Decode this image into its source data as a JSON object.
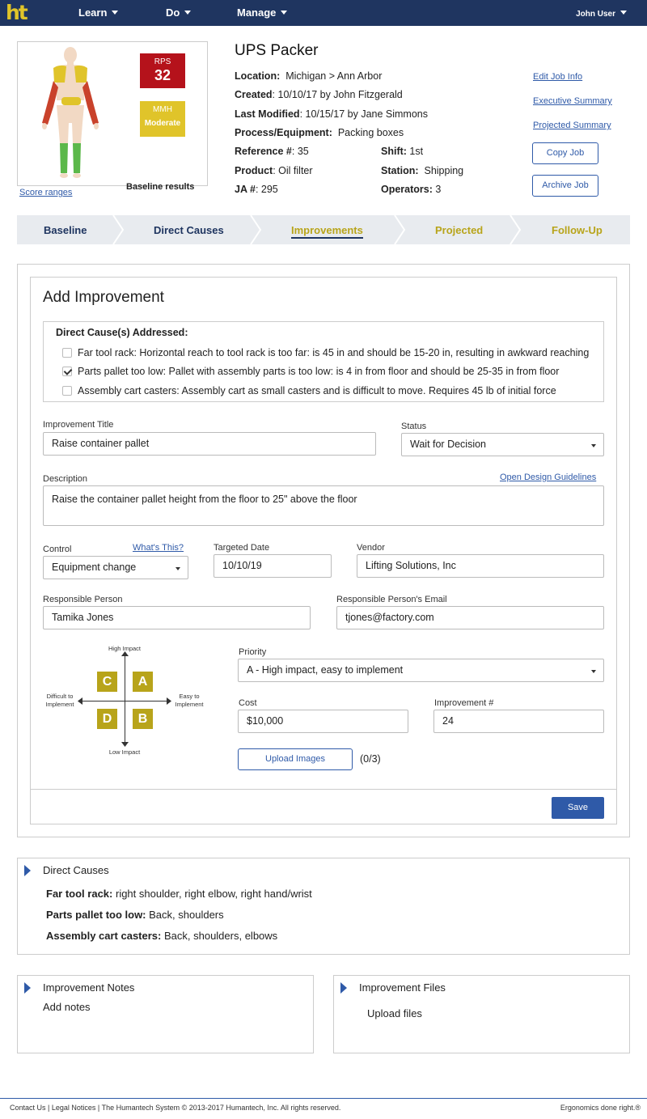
{
  "nav": {
    "logo": "ht",
    "learn": "Learn",
    "do": "Do",
    "manage": "Manage",
    "user": "John User"
  },
  "job": {
    "title": "UPS Packer",
    "rps_label": "RPS",
    "rps_value": "32",
    "mmh_label": "MMH",
    "mmh_value": "Moderate",
    "baseline_label": "Baseline results",
    "score_ranges": "Score ranges",
    "location_label": "Location:",
    "location": "Michigan > Ann Arbor",
    "created_label": "Created",
    "created": ": 10/10/17 by John Fitzgerald",
    "modified_label": "Last Modified",
    "modified": ": 10/15/17 by Jane Simmons",
    "process_label": "Process/Equipment:",
    "process": "Packing boxes",
    "reference_label": "Reference #",
    "reference": ": 35",
    "shift_label": "Shift:",
    "shift": "1st",
    "product_label": "Product",
    "product": ": Oil filter",
    "station_label": "Station:",
    "station": "Shipping",
    "ja_label": "JA #",
    "ja": ": 295",
    "operators_label": "Operators:",
    "operators": "3"
  },
  "actions": {
    "edit": "Edit Job Info",
    "executive": "Executive Summary",
    "projected": "Projected Summary",
    "copy": "Copy Job",
    "archive": "Archive Job"
  },
  "steps": [
    "Baseline",
    "Direct Causes",
    "Improvements",
    "Projected",
    "Follow-Up"
  ],
  "colors": {
    "nav_bg": "#1f3560",
    "accent": "#2f5aa8",
    "rps_red": "#b5121b",
    "yellow": "#e0c42a",
    "olive": "#b8a41a",
    "step_dark": "#1f3560"
  },
  "form": {
    "heading": "Add Improvement",
    "causes_title": "Direct Cause(s) Addressed:",
    "causes": [
      {
        "text": "Far tool rack: Horizontal reach to tool rack is too far: is 45 in and should be 15-20 in, resulting in awkward reaching",
        "checked": false
      },
      {
        "text": "Parts pallet too low: Pallet with assembly parts is too low: is 4 in from floor and should be 25-35 in from floor",
        "checked": true
      },
      {
        "text": "Assembly cart casters: Assembly cart as small casters and is difficult to move. Requires 45 lb of initial force",
        "checked": false
      }
    ],
    "title_label": "Improvement Title",
    "title_value": "Raise container pallet",
    "status_label": "Status",
    "status_value": "Wait for Decision",
    "desc_label": "Description",
    "desc_link": "Open Design Guidelines",
    "desc_value": "Raise the container pallet height from the floor to 25\" above the floor",
    "control_label": "Control",
    "control_link": "What's This?",
    "control_value": "Equipment change",
    "date_label": "Targeted Date",
    "date_value": "10/10/19",
    "vendor_label": "Vendor",
    "vendor_value": "Lifting Solutions, Inc",
    "person_label": "Responsible Person",
    "person_value": "Tamika Jones",
    "email_label": "Responsible Person's Email",
    "email_value": "tjones@factory.com",
    "priority_label": "Priority",
    "priority_value": "A - High impact, easy to implement",
    "cost_label": "Cost",
    "cost_value": "$10,000",
    "num_label": "Improvement #",
    "num_value": "24",
    "upload": "Upload Images",
    "upload_count": "(0/3)",
    "save": "Save"
  },
  "quadrant": {
    "high": "High Impact",
    "low": "Low Impact",
    "difficult_1": "Difficult to",
    "difficult_2": "Implement",
    "easy_1": "Easy to",
    "easy_2": "Implement",
    "c": "C",
    "a": "A",
    "d": "D",
    "b": "B"
  },
  "direct_causes": {
    "title": "Direct Causes",
    "items": [
      {
        "name": "Far tool rack:",
        "parts": "right shoulder, right elbow, right hand/wrist"
      },
      {
        "name": "Parts pallet too low:",
        "parts": "Back, shoulders"
      },
      {
        "name": "Assembly cart casters:",
        "parts": "Back, shoulders, elbows"
      }
    ]
  },
  "notes": {
    "title": "Improvement Notes",
    "placeholder": "Add notes"
  },
  "files": {
    "title": "Improvement Files",
    "placeholder": "Upload files"
  },
  "footer": {
    "contact": "Contact Us",
    "legal": "Legal Notices",
    "copyright": "The Humantech System © 2013-2017 Humantech, Inc. All rights reserved.",
    "tagline": "Ergonomics done right.®"
  }
}
